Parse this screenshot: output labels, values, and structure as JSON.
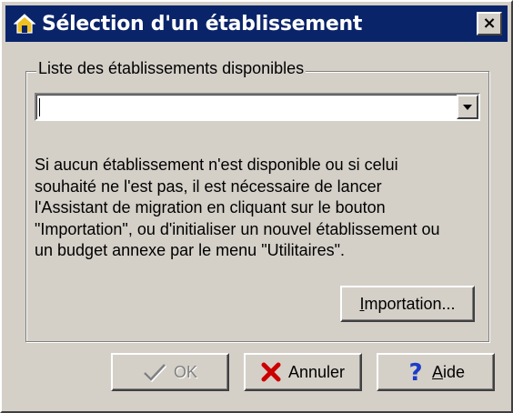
{
  "window": {
    "title": "Sélection d'un établissement",
    "close_label": "×",
    "title_icon": "house-icon",
    "colors": {
      "titlebar": "#0a246a",
      "face": "#d4d0c8"
    }
  },
  "group": {
    "legend": "Liste des établissements disponibles"
  },
  "establishment_select": {
    "value": "",
    "arrow_icon": "chevron-down-icon"
  },
  "info": {
    "text": "Si aucun établissement n'est disponible ou si celui\nsouhaité ne l'est pas, il est nécessaire de lancer\nl'Assistant de migration en cliquant sur le bouton\n\"Importation\", ou d'initialiser un nouvel établissement ou\nun budget annexe par le menu \"Utilitaires\"."
  },
  "buttons": {
    "import_mnemonic": "I",
    "import_rest": "mportation...",
    "ok_label": "OK",
    "ok_icon": "checkmark-icon",
    "ok_enabled": false,
    "cancel_label": "Annuler",
    "cancel_icon": "red-x-icon",
    "help_mnemonic": "A",
    "help_rest": "ide",
    "help_icon": "question-mark-icon"
  }
}
